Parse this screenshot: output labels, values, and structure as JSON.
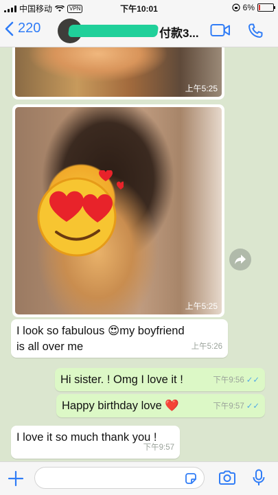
{
  "status": {
    "carrier": "中国移动",
    "vpn": "VPN",
    "time": "下午10:01",
    "battery": "6%"
  },
  "header": {
    "back_count": "220",
    "title": "付款3...",
    "icons": [
      "video-call-icon",
      "phone-icon"
    ]
  },
  "messages": [
    {
      "type": "photo",
      "direction": "in",
      "time": "上午5:25"
    },
    {
      "type": "photo",
      "direction": "in",
      "time": "上午5:25"
    },
    {
      "type": "text",
      "direction": "in",
      "text_line1": "I look so fabulous 😍my boyfriend",
      "text_line2": "is all over me",
      "time": "上午5:26"
    },
    {
      "type": "text",
      "direction": "out",
      "text": "Hi sister. ! Omg I love it !",
      "time": "下午9:56",
      "ticks": "✓✓"
    },
    {
      "type": "text",
      "direction": "out",
      "text": "Happy birthday love ❤️",
      "time": "下午9:57",
      "ticks": "✓✓"
    },
    {
      "type": "text",
      "direction": "in",
      "text": "I love it so much thank you !",
      "time": "下午9:57"
    }
  ],
  "composer": {
    "placeholder": ""
  },
  "colors": {
    "accent": "#2f7cf6",
    "outgoing_bubble": "#dcf8c6",
    "incoming_bubble": "#ffffff",
    "chat_background": "#dbe6cf",
    "read_ticks": "#4fa8e6"
  }
}
